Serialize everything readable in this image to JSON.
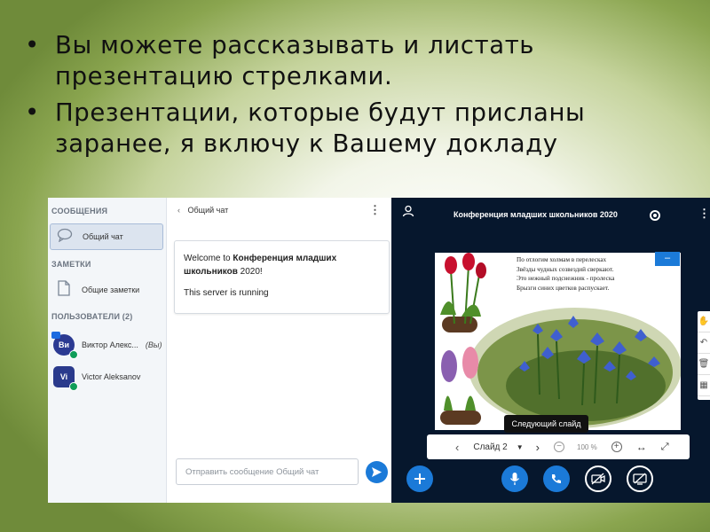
{
  "bullets": [
    "Вы можете рассказывать и листать презентацию стрелками.",
    "Презентации, которые будут присланы заранее, я включу к Вашему докладу"
  ],
  "sidebar": {
    "messages_header": "СООБЩЕНИЯ",
    "public_chat": "Общий чат",
    "notes_header": "ЗАМЕТКИ",
    "shared_notes": "Общие заметки",
    "users_header": "ПОЛЬЗОВАТЕЛИ (2)",
    "users": [
      {
        "initials": "Ви",
        "name": "Виктор Алекс...",
        "you": "(Вы)"
      },
      {
        "initials": "Vi",
        "name": "Victor Aleksanov"
      }
    ]
  },
  "chat": {
    "title": "Общий чат",
    "welcome_prefix": "Welcome to ",
    "welcome_name": "Конференция младших школьников",
    "welcome_year": " 2020!",
    "status": "This server is running",
    "input_placeholder": "Отправить сообщение Общий чат"
  },
  "presentation": {
    "title": "Конференция младших школьников 2020",
    "poem": [
      "По отлогим холмам в перелесках",
      "Звёзды чудных созвездий сверкают.",
      "Это  нежный подснежник - пролеска",
      "Брызги синих цветков распускает."
    ],
    "tooltip": "Следующий слайд",
    "slide_label": "Слайд 2",
    "zoom": "100 %"
  },
  "colors": {
    "accent": "#1b7ad8",
    "presentation_bg": "#06172d",
    "online": "#0f9d58"
  }
}
